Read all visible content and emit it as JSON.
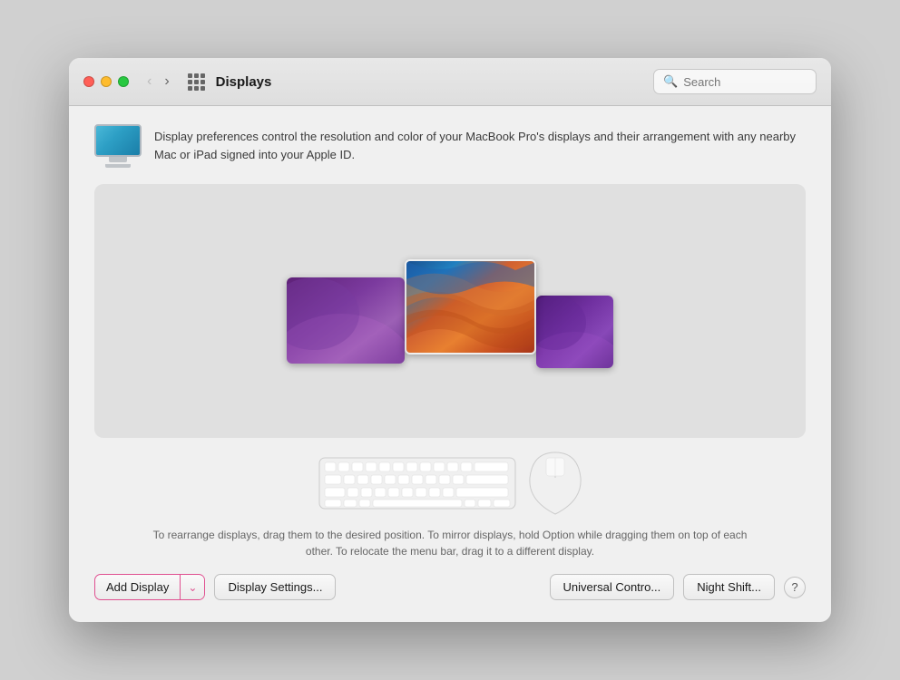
{
  "window": {
    "title": "Displays"
  },
  "titlebar": {
    "title": "Displays",
    "search_placeholder": "Search",
    "back_arrow": "‹",
    "forward_arrow": "›"
  },
  "header": {
    "description": "Display preferences control the resolution and color of your MacBook Pro's displays and their arrangement with any nearby Mac or iPad signed into your Apple ID."
  },
  "instructions": {
    "text": "To rearrange displays, drag them to the desired position. To mirror displays, hold Option while dragging them on top of each other. To relocate the menu bar, drag it to a different display."
  },
  "buttons": {
    "add_display": "Add Display",
    "display_settings": "Display Settings...",
    "universal_control": "Universal Contro...",
    "night_shift": "Night Shift...",
    "help": "?"
  }
}
